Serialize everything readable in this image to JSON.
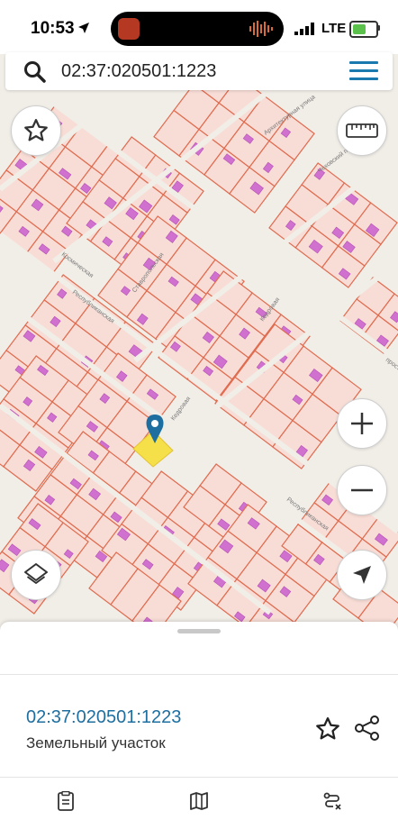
{
  "status_bar": {
    "time": "10:53",
    "network": "LTE",
    "battery_level": 0.6
  },
  "search": {
    "value": "02:37:020501:1223"
  },
  "map": {
    "street_labels": [
      "Архитектурная улица",
      "Чеховский переулок",
      "Космическая",
      "Республиканская",
      "Ставропольская",
      "Кедровая",
      "Кедровая",
      "Республиканская",
      "прост"
    ],
    "colors": {
      "background": "#f1ede7",
      "parcel_fill": "#f8ddd6",
      "parcel_line": "#e06b4f",
      "building": "#d070cf",
      "selection": "#f6e04a",
      "marker": "#1e6fa0"
    }
  },
  "controls": {
    "favorite_icon": "star-outline-icon",
    "ruler_icon": "ruler-icon",
    "zoom_in_icon": "plus-icon",
    "zoom_out_icon": "minus-icon",
    "layers_icon": "layers-icon",
    "locate_icon": "navigation-arrow-icon"
  },
  "panel": {
    "parcel_id": "02:37:020501:1223",
    "parcel_type": "Земельный участок",
    "tabs": [
      "info-icon",
      "map-icon",
      "route-icon"
    ]
  }
}
